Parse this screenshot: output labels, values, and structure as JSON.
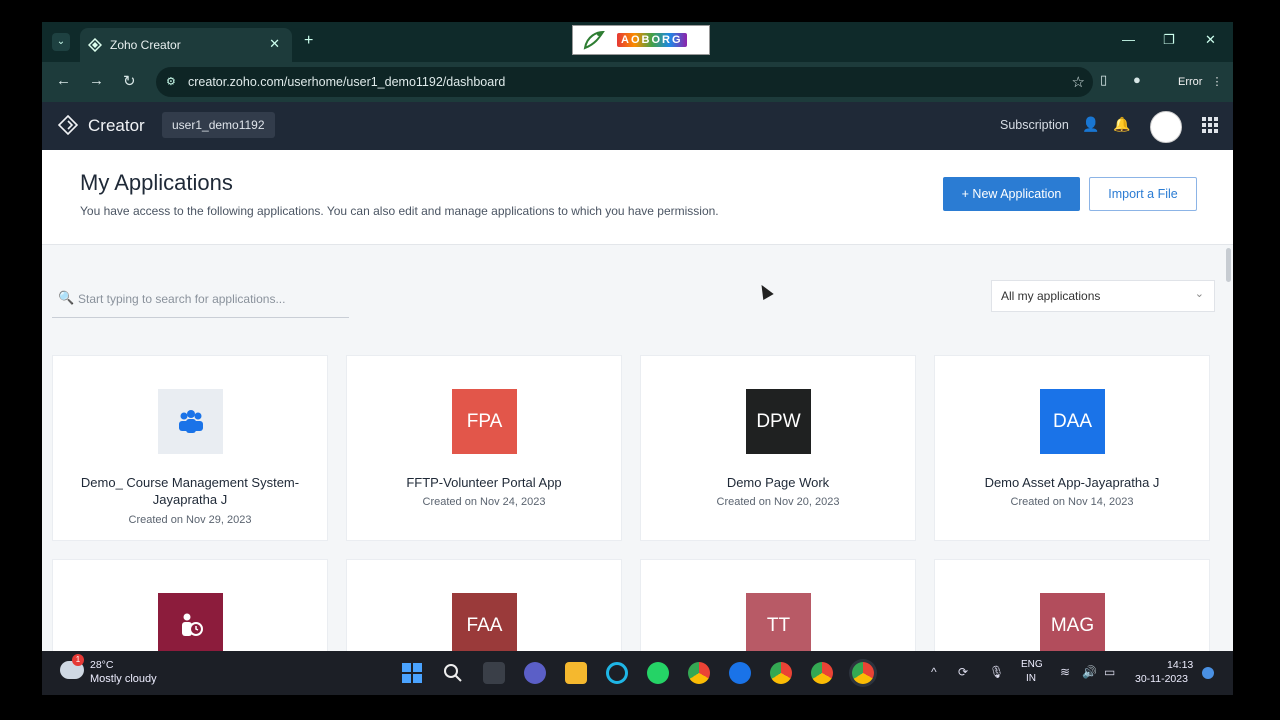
{
  "browser": {
    "tab_title": "Zoho Creator",
    "url": "creator.zoho.com/userhome/user1_demo1192/dashboard",
    "profile_status": "Error",
    "brand_logo_text": "AOBORG"
  },
  "header": {
    "app_name": "Creator",
    "username": "user1_demo1192",
    "subscription_label": "Subscription"
  },
  "page": {
    "title": "My Applications",
    "description": "You have access to the following applications. You can also edit and manage applications to which you have permission.",
    "new_app_label": "+ New Application",
    "import_label": "Import a File",
    "search_placeholder": "Start typing to search for applications...",
    "filter_label": "All my applications"
  },
  "apps": [
    {
      "name": "Demo_ Course Management System-Jayapratha J",
      "date": "Created on Nov 29, 2023",
      "icon_text": "",
      "icon": "people-group-icon",
      "color": "#e9edf2"
    },
    {
      "name": "FFTP-Volunteer Portal App",
      "date": "Created on Nov 24, 2023",
      "icon_text": "FPA",
      "color": "#e2564a"
    },
    {
      "name": "Demo Page Work",
      "date": "Created on Nov 20, 2023",
      "icon_text": "DPW",
      "color": "#1f2121"
    },
    {
      "name": "Demo Asset App-Jayapratha J",
      "date": "Created on Nov 14, 2023",
      "icon_text": "DAA",
      "color": "#1a73e8"
    },
    {
      "name": "",
      "date": "",
      "icon_text": "",
      "icon": "person-clock-icon",
      "color": "#8c1c3c"
    },
    {
      "name": "",
      "date": "",
      "icon_text": "FAA",
      "color": "#9a3a3a"
    },
    {
      "name": "",
      "date": "",
      "icon_text": "TT",
      "color": "#b85a66"
    },
    {
      "name": "",
      "date": "",
      "icon_text": "MAG",
      "color": "#b24d5c"
    }
  ],
  "taskbar": {
    "weather_temp": "28°C",
    "weather_desc": "Mostly cloudy",
    "weather_badge": "1",
    "lang_line1": "ENG",
    "lang_line2": "IN",
    "time": "14:13",
    "date": "30-11-2023"
  }
}
